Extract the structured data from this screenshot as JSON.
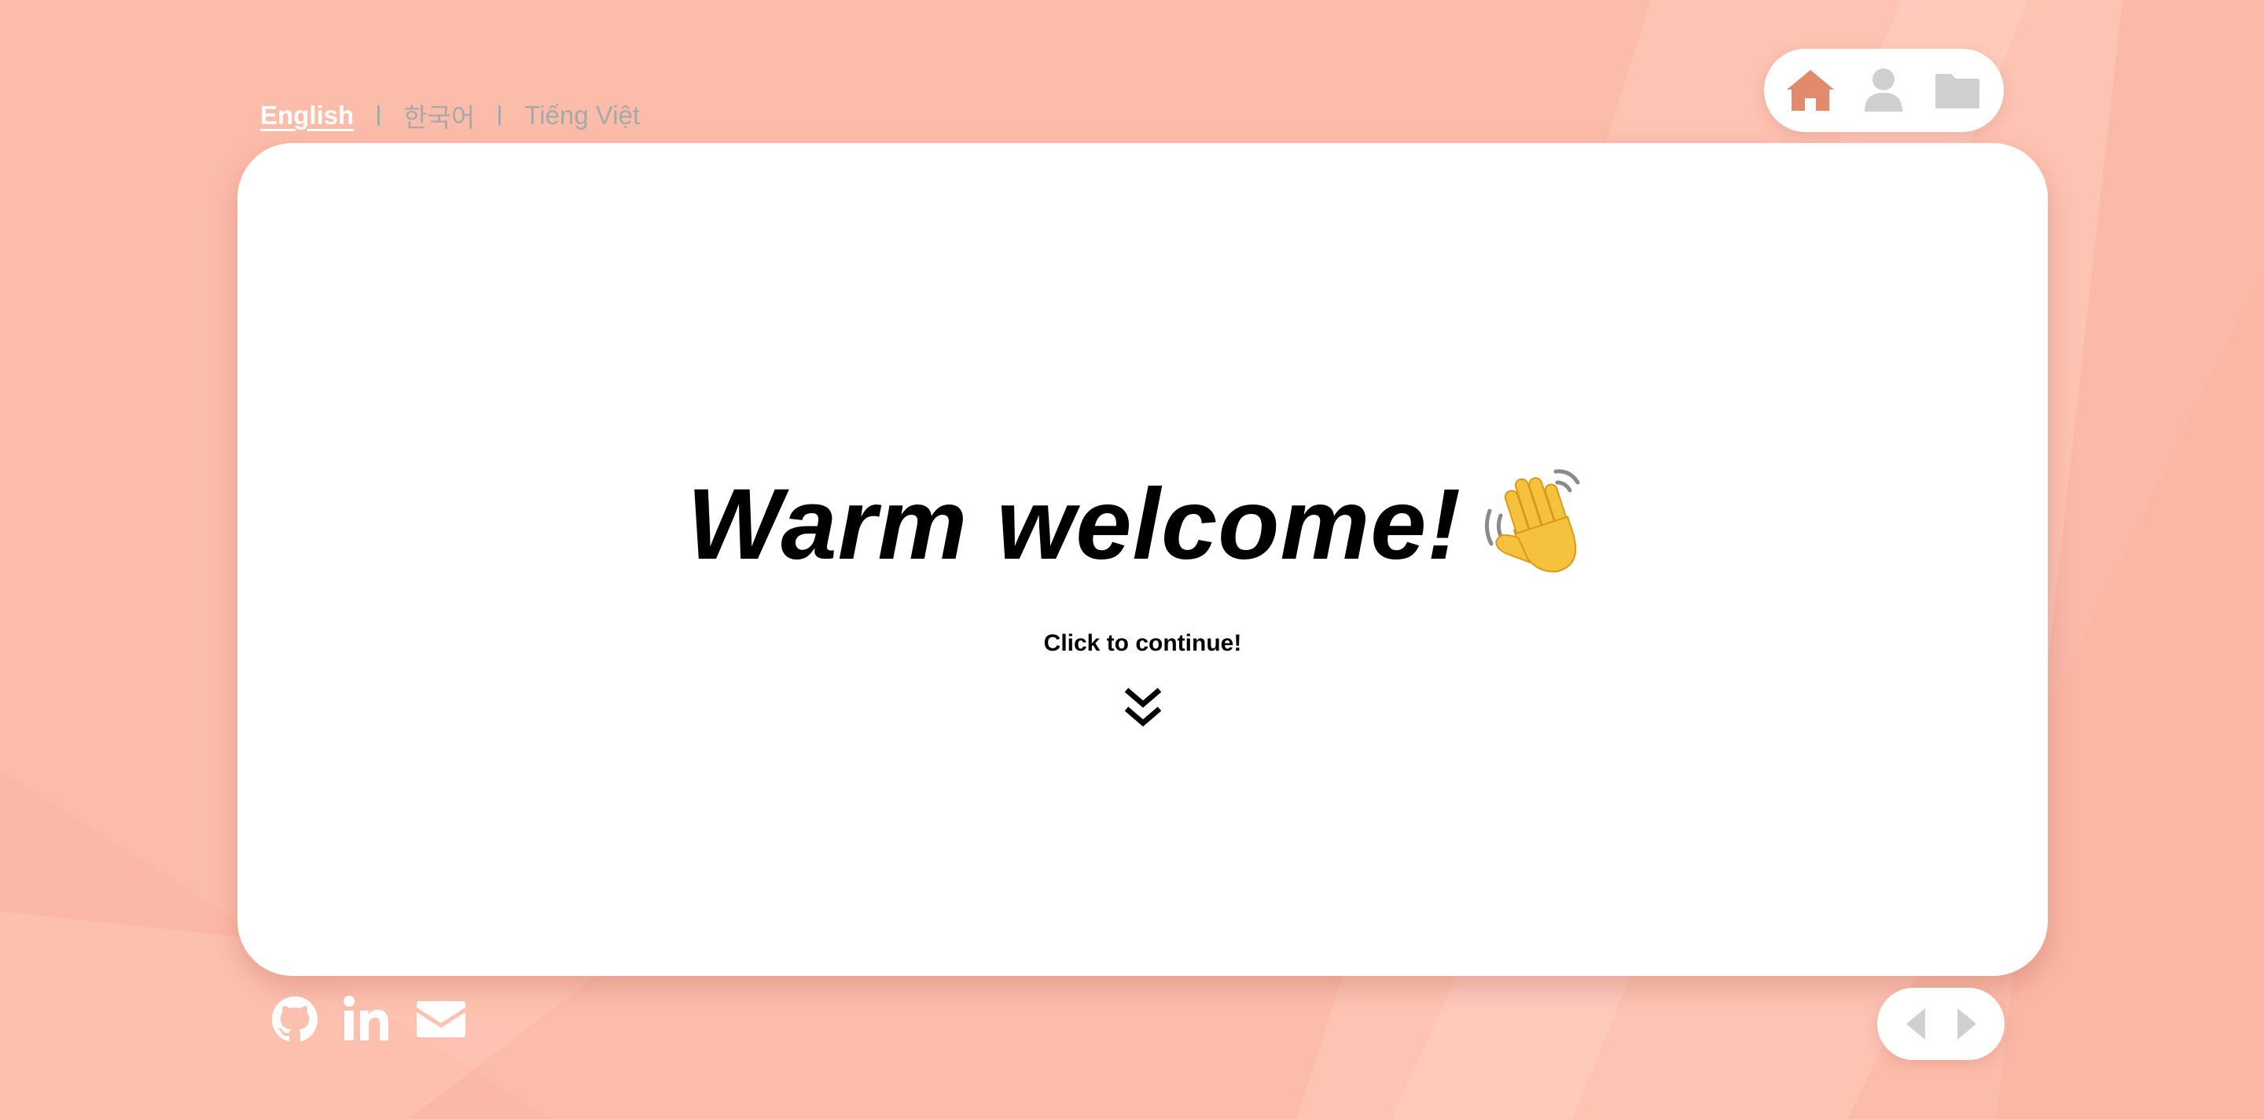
{
  "languages": [
    {
      "label": "English",
      "active": true
    },
    {
      "label": "한국어",
      "active": false
    },
    {
      "label": "Tiếng Việt",
      "active": false
    }
  ],
  "top_nav": {
    "items": [
      {
        "icon": "home-icon",
        "active": true
      },
      {
        "icon": "user-icon",
        "active": false
      },
      {
        "icon": "folder-icon",
        "active": false
      }
    ]
  },
  "main": {
    "title": "Warm welcome!",
    "emoji": "waving-hand-icon",
    "continue_label": "Click to continue!",
    "continue_icon": "chevron-double-down-icon"
  },
  "social": [
    {
      "icon": "github-icon"
    },
    {
      "icon": "linkedin-icon"
    },
    {
      "icon": "mail-icon"
    }
  ],
  "pager": {
    "prev_icon": "arrow-left-icon",
    "next_icon": "arrow-right-icon"
  },
  "colors": {
    "background": "#fcbcaa",
    "accent": "#e28a6c",
    "inactive_icon": "#d0d0d0",
    "card": "#ffffff"
  }
}
